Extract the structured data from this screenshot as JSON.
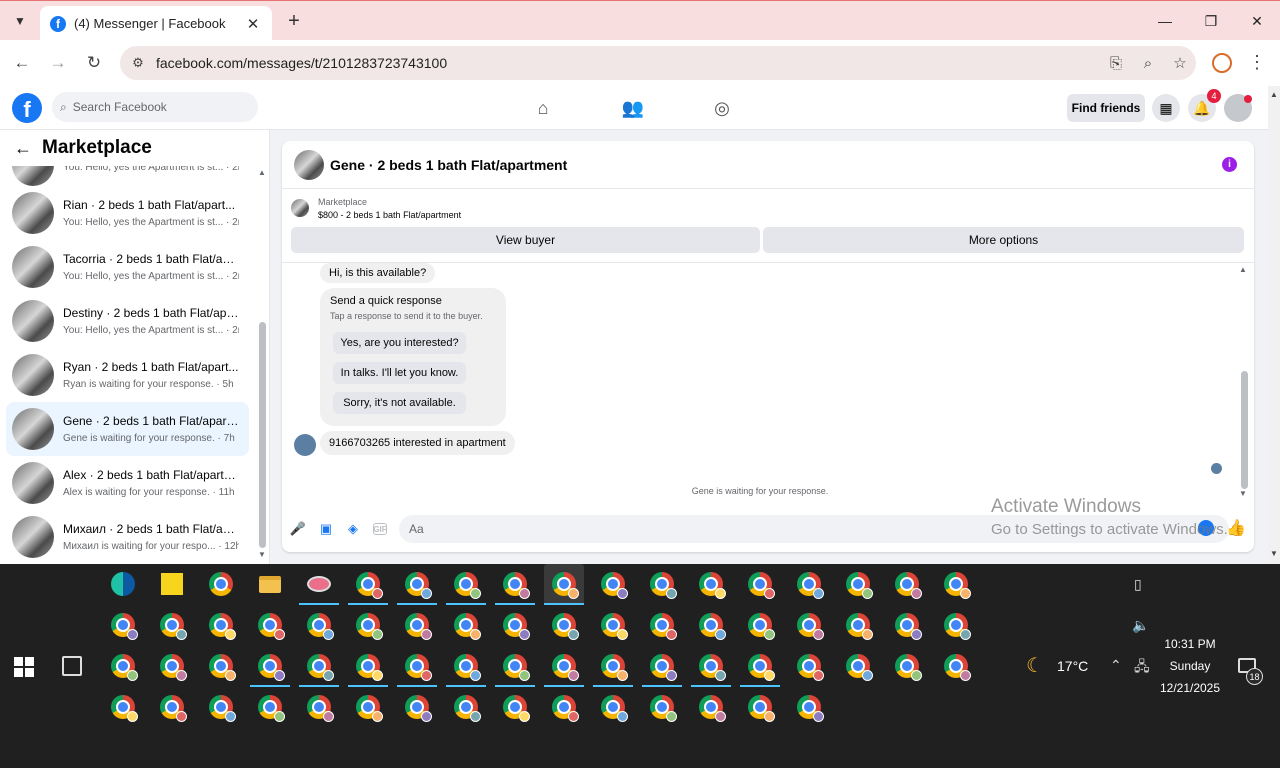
{
  "browser": {
    "tab_title": "(4) Messenger | Facebook",
    "url": "facebook.com/messages/t/2101283723743100"
  },
  "facebook": {
    "search_placeholder": "Search Facebook",
    "find_friends_label": "Find friends",
    "notification_count": "4",
    "brand_color": "#1877f2"
  },
  "sidebar": {
    "title": "Marketplace",
    "conversations": [
      {
        "name": "",
        "preview": "You: Hello, yes the Apartment is st...",
        "time": "2m"
      },
      {
        "name": "Rian · 2 beds 1 bath Flat/apart...",
        "preview": "You: Hello, yes the Apartment is st...",
        "time": "2m"
      },
      {
        "name": "Tacorria · 2 beds 1 bath Flat/apa...",
        "preview": "You: Hello, yes the Apartment is st...",
        "time": "2m"
      },
      {
        "name": "Destiny · 2 beds 1 bath Flat/apa...",
        "preview": "You: Hello, yes the Apartment is st...",
        "time": "2m"
      },
      {
        "name": "Ryan · 2 beds 1 bath Flat/apart...",
        "preview": "Ryan is waiting for your response.",
        "time": "5h"
      },
      {
        "name": "Gene · 2 beds 1 bath Flat/apart...",
        "preview": "Gene is waiting for your response.",
        "time": "7h"
      },
      {
        "name": "Alex · 2 beds 1 bath Flat/apartm...",
        "preview": "Alex is waiting for your response.",
        "time": "11h"
      },
      {
        "name": "Михаил · 2 beds 1 bath Flat/ap...",
        "preview": "Михаил is waiting for your respo...",
        "time": "12h"
      }
    ]
  },
  "chat": {
    "title": "Gene · 2 beds 1 bath Flat/apartment",
    "marketplace_label": "Marketplace",
    "listing": "$800 - 2 beds 1 bath Flat/apartment",
    "view_buyer_label": "View buyer",
    "more_options_label": "More options",
    "first_message": "Hi, is this available?",
    "quick_response_title": "Send a quick response",
    "quick_response_subtitle": "Tap a response to send it to the buyer.",
    "quick_responses": [
      "Yes, are you interested?",
      "In talks. I'll let you know.",
      "Sorry, it's not available."
    ],
    "last_message": "9166703265 interested in apartment",
    "waiting_note": "Gene is waiting for your response.",
    "composer_placeholder": "Aa"
  },
  "watermark": {
    "line1": "Activate Windows",
    "line2": "Go to Settings to activate Windows."
  },
  "taskbar": {
    "temperature": "17°C",
    "time": "10:31 PM",
    "day": "Sunday",
    "date": "12/21/2025",
    "notifications": "18"
  }
}
